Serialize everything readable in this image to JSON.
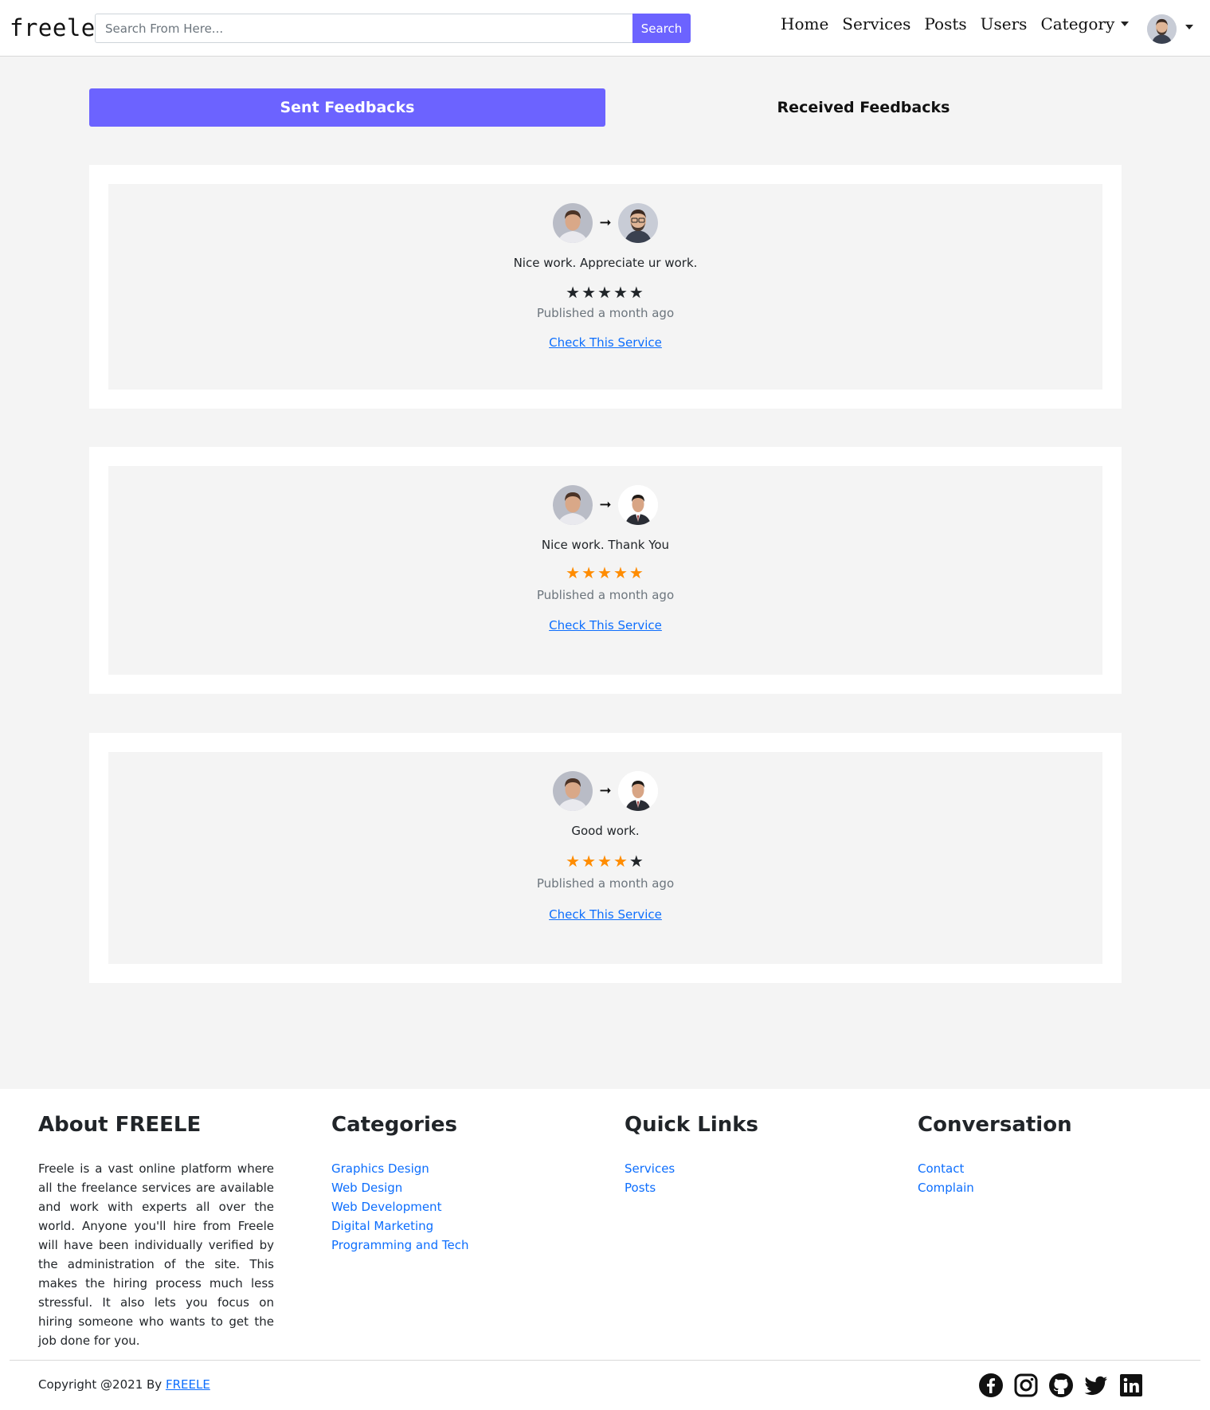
{
  "nav": {
    "brand": "freele",
    "search_placeholder": "Search From Here...",
    "search_button": "Search",
    "links": [
      "Home",
      "Services",
      "Posts",
      "Users",
      "Category"
    ]
  },
  "tabs": {
    "sent": "Sent Feedbacks",
    "received": "Received Feedbacks"
  },
  "feedbacks": [
    {
      "text": "Nice work. Appreciate ur work.",
      "rating": 5,
      "star_color": "#212529",
      "published": "Published a month ago",
      "link": "Check This Service"
    },
    {
      "text": "Nice work. Thank You",
      "rating": 5,
      "star_color": "#ff8c00",
      "published": "Published a month ago",
      "link": "Check This Service"
    },
    {
      "text": "Good work.",
      "rating": 4,
      "star_color": "#ff8c00",
      "published": "Published a month ago",
      "link": "Check This Service"
    }
  ],
  "footer": {
    "about_title": "About FREELE",
    "about_text": "Freele is a vast online platform where all the freelance services are available and work with experts all over the world. Anyone you'll hire from Freele will have been individually verified by the administration of the site. This makes the hiring process much less stressful. It also lets you focus on hiring someone who wants to get the job done for you.",
    "categories_title": "Categories",
    "categories": [
      "Graphics Design",
      "Web Design",
      "Web Development",
      "Digital Marketing",
      "Programming and Tech"
    ],
    "quick_title": "Quick Links",
    "quick": [
      "Services",
      "Posts"
    ],
    "conv_title": "Conversation",
    "conv": [
      "Contact",
      "Complain"
    ],
    "copyright_prefix": "Copyright @2021 By",
    "copyright_brand": "FREELE"
  },
  "colors": {
    "accent": "#6c63ff",
    "link": "#0d6efd",
    "star_orange": "#ff8c00",
    "star_dark": "#212529"
  }
}
